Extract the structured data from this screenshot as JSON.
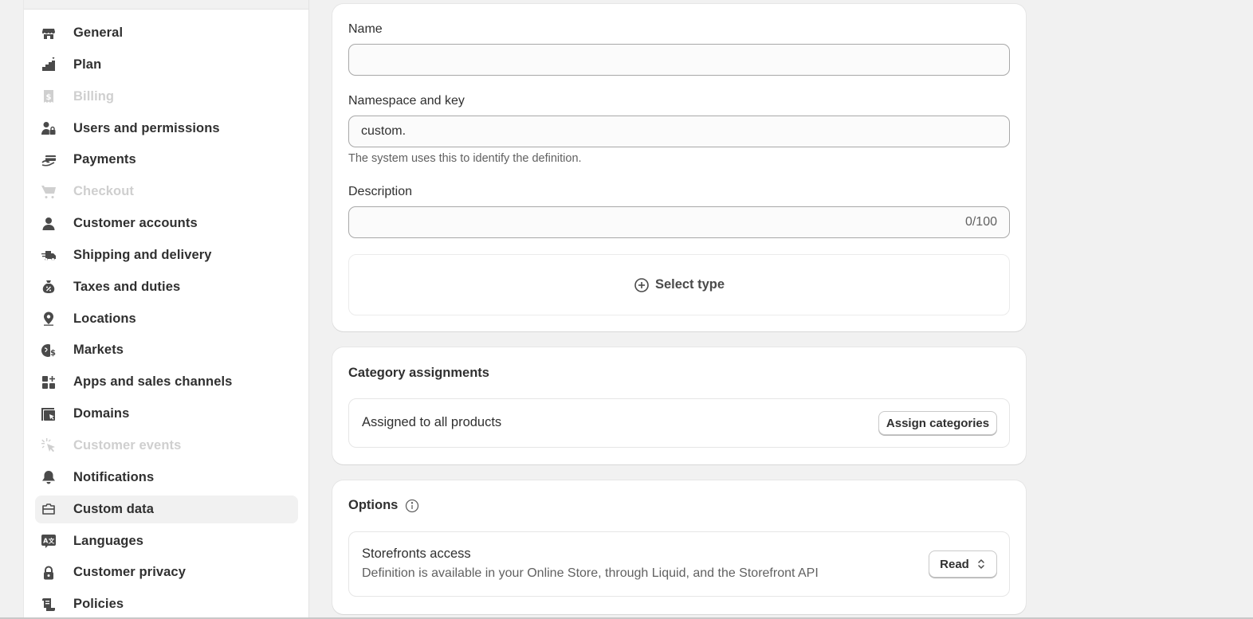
{
  "sidebar": {
    "items": [
      {
        "label": "General",
        "icon": "store-icon",
        "disabled": false,
        "active": false
      },
      {
        "label": "Plan",
        "icon": "plan-icon",
        "disabled": false,
        "active": false
      },
      {
        "label": "Billing",
        "icon": "receipt-dollar-icon",
        "disabled": true,
        "active": false
      },
      {
        "label": "Users and permissions",
        "icon": "user-lock-icon",
        "disabled": false,
        "active": false
      },
      {
        "label": "Payments",
        "icon": "hand-card-icon",
        "disabled": false,
        "active": false
      },
      {
        "label": "Checkout",
        "icon": "cart-icon",
        "disabled": true,
        "active": false
      },
      {
        "label": "Customer accounts",
        "icon": "person-icon",
        "disabled": false,
        "active": false
      },
      {
        "label": "Shipping and delivery",
        "icon": "delivery-truck-icon",
        "disabled": false,
        "active": false
      },
      {
        "label": "Taxes and duties",
        "icon": "tax-bag-icon",
        "disabled": false,
        "active": false
      },
      {
        "label": "Locations",
        "icon": "location-pin-icon",
        "disabled": false,
        "active": false
      },
      {
        "label": "Markets",
        "icon": "globe-dollar-icon",
        "disabled": false,
        "active": false
      },
      {
        "label": "Apps and sales channels",
        "icon": "apps-plus-icon",
        "disabled": false,
        "active": false
      },
      {
        "label": "Domains",
        "icon": "domain-window-icon",
        "disabled": false,
        "active": false
      },
      {
        "label": "Customer events",
        "icon": "cursor-click-icon",
        "disabled": true,
        "active": false
      },
      {
        "label": "Notifications",
        "icon": "bell-icon",
        "disabled": false,
        "active": false
      },
      {
        "label": "Custom data",
        "icon": "metafield-box-icon",
        "disabled": false,
        "active": true
      },
      {
        "label": "Languages",
        "icon": "translate-icon",
        "disabled": false,
        "active": false
      },
      {
        "label": "Customer privacy",
        "icon": "lock-icon",
        "disabled": false,
        "active": false
      },
      {
        "label": "Policies",
        "icon": "policy-scroll-icon",
        "disabled": false,
        "active": false
      }
    ]
  },
  "definition": {
    "name_label": "Name",
    "name_value": "",
    "namespace_label": "Namespace and key",
    "namespace_value": "custom.",
    "namespace_help": "The system uses this to identify the definition.",
    "description_label": "Description",
    "description_value": "",
    "description_counter": "0/100",
    "select_type_label": "Select type"
  },
  "category": {
    "title": "Category assignments",
    "status_text": "Assigned to all products",
    "assign_button": "Assign categories"
  },
  "options": {
    "title": "Options",
    "storefront_title": "Storefronts access",
    "storefront_desc": "Definition is available in your Online Store, through Liquid, and the Storefront API",
    "storefront_value": "Read"
  }
}
